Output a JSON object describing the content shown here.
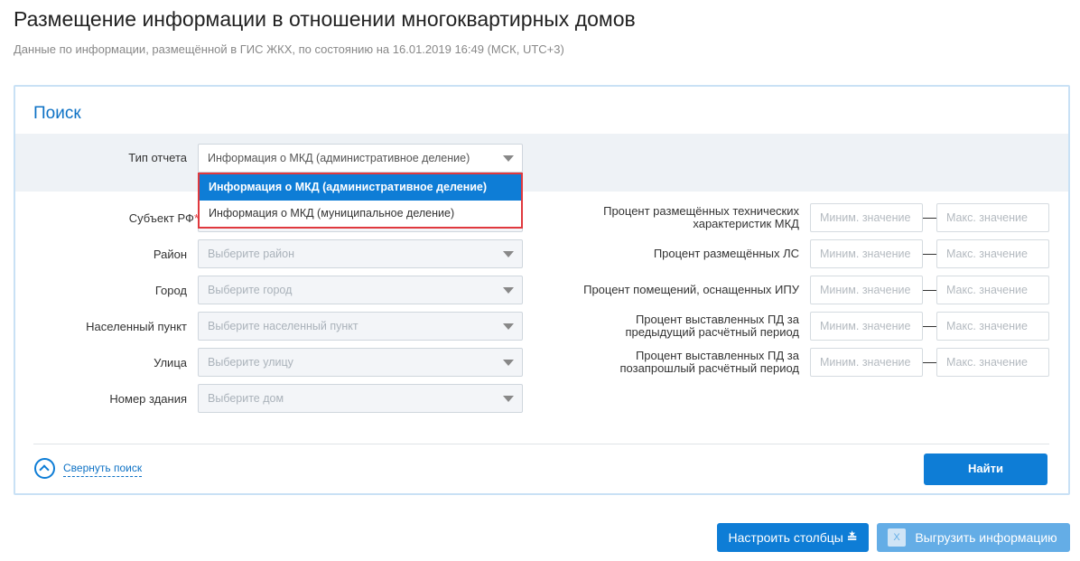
{
  "header": {
    "title": "Размещение информации в отношении многоквартирных домов",
    "subtitle": "Данные по информации, размещённой в ГИС ЖКХ, по состоянию на 16.01.2019 16:49 (МСК, UTC+3)"
  },
  "search": {
    "title": "Поиск",
    "report_type": {
      "label": "Тип отчета",
      "value": "Информация о МКД (административное деление)",
      "options": [
        "Информация о МКД (административное деление)",
        "Информация о МКД (муниципальное деление)"
      ]
    },
    "left_fields": [
      {
        "label": "Субъект РФ",
        "required": "*",
        "placeholder": ""
      },
      {
        "label": "Район",
        "placeholder": "Выберите район"
      },
      {
        "label": "Город",
        "placeholder": "Выберите город"
      },
      {
        "label": "Населенный пункт",
        "placeholder": "Выберите населенный пункт"
      },
      {
        "label": "Улица",
        "placeholder": "Выберите улицу"
      },
      {
        "label": "Номер здания",
        "placeholder": "Выберите дом"
      }
    ],
    "right_fields": [
      {
        "label1": "Процент размещённых технических",
        "label2": "характеристик МКД"
      },
      {
        "label1": "Процент размещённых ЛС",
        "label2": ""
      },
      {
        "label1": "Процент помещений, оснащенных ИПУ",
        "label2": ""
      },
      {
        "label1": "Процент выставленных ПД за",
        "label2": "предыдущий расчётный период"
      },
      {
        "label1": "Процент выставленных ПД за",
        "label2": "позапрошлый расчётный период"
      }
    ],
    "min_placeholder": "Миним. значение",
    "max_placeholder": "Макс. значение",
    "collapse_label": "Свернуть поиск",
    "find_label": "Найти"
  },
  "actions": {
    "columns_label": "Настроить столбцы",
    "export_label": "Выгрузить информацию"
  }
}
